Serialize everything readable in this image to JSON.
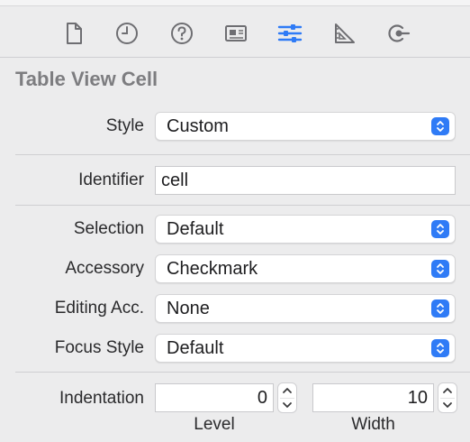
{
  "toolbar": {
    "icons": [
      "file-icon",
      "clock-icon",
      "help-icon",
      "id-card-icon",
      "sliders-icon",
      "ruler-icon",
      "connections-icon"
    ],
    "active_icon": "sliders-icon",
    "accent": "#2f7bf6"
  },
  "section": {
    "title": "Table View Cell"
  },
  "fields": {
    "style": {
      "label": "Style",
      "value": "Custom"
    },
    "identifier": {
      "label": "Identifier",
      "value": "cell"
    },
    "selection": {
      "label": "Selection",
      "value": "Default"
    },
    "accessory": {
      "label": "Accessory",
      "value": "Checkmark"
    },
    "editing_acc": {
      "label": "Editing Acc.",
      "value": "None"
    },
    "focus_style": {
      "label": "Focus Style",
      "value": "Default"
    },
    "indentation": {
      "label": "Indentation",
      "level_value": "0",
      "level_label": "Level",
      "width_value": "10",
      "width_label": "Width"
    }
  }
}
